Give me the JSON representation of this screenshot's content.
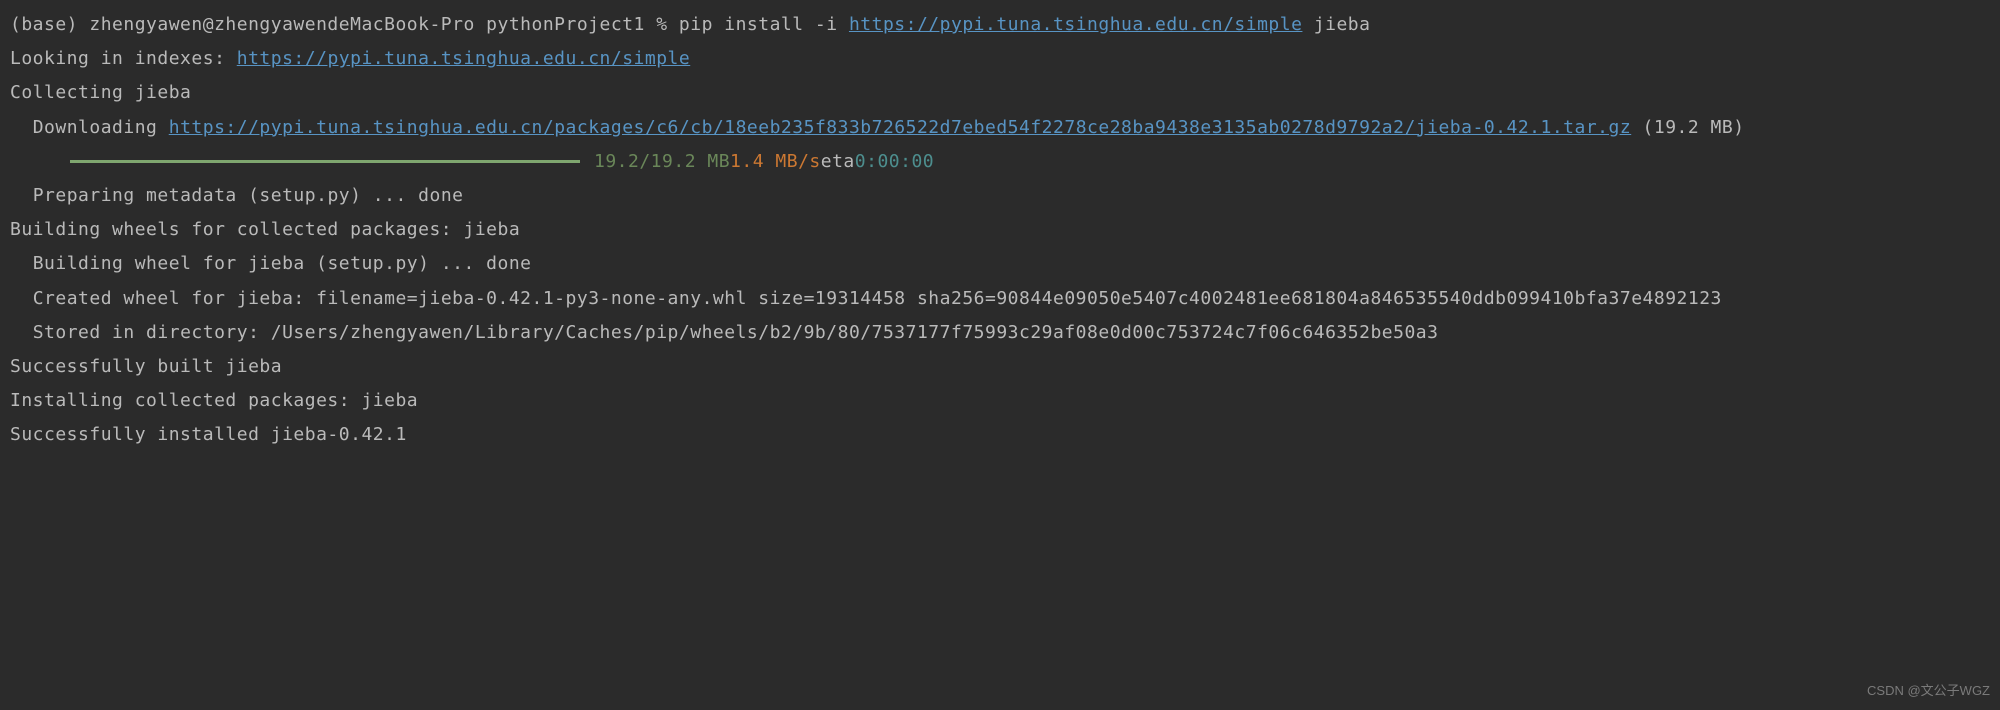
{
  "prompt": {
    "prefix": "(base) zhengyawen@zhengyawendeMacBook-Pro pythonProject1 % ",
    "cmd_part1": "pip install -i ",
    "url": "https://pypi.tuna.tsinghua.edu.cn/simple",
    "cmd_part2": " jieba"
  },
  "lines": {
    "looking_prefix": "Looking in indexes: ",
    "looking_url": "https://pypi.tuna.tsinghua.edu.cn/simple",
    "collecting": "Collecting jieba",
    "downloading_prefix": "  Downloading ",
    "downloading_url": "https://pypi.tuna.tsinghua.edu.cn/packages/c6/cb/18eeb235f833b726522d7ebed54f2278ce28ba9438e3135ab0278d9792a2/jieba-0.42.1.tar.gz",
    "downloading_size": " (19.2 MB)",
    "progress_size": "19.2/19.2 MB",
    "progress_speed": " 1.4 MB/s",
    "progress_eta_label": " eta ",
    "progress_eta": "0:00:00",
    "preparing": "  Preparing metadata (setup.py) ... done",
    "building": "Building wheels for collected packages: jieba",
    "building_wheel": "  Building wheel for jieba (setup.py) ... done",
    "created_wheel": "  Created wheel for jieba: filename=jieba-0.42.1-py3-none-any.whl size=19314458 sha256=90844e09050e5407c4002481ee681804a846535540ddb099410bfa37e4892123",
    "stored": "  Stored in directory: /Users/zhengyawen/Library/Caches/pip/wheels/b2/9b/80/7537177f75993c29af08e0d00c753724c7f06c646352be50a3",
    "success_built": "Successfully built jieba",
    "installing": "Installing collected packages: jieba",
    "success_installed": "Successfully installed jieba-0.42.1"
  },
  "watermark": "CSDN @文公子WGZ"
}
